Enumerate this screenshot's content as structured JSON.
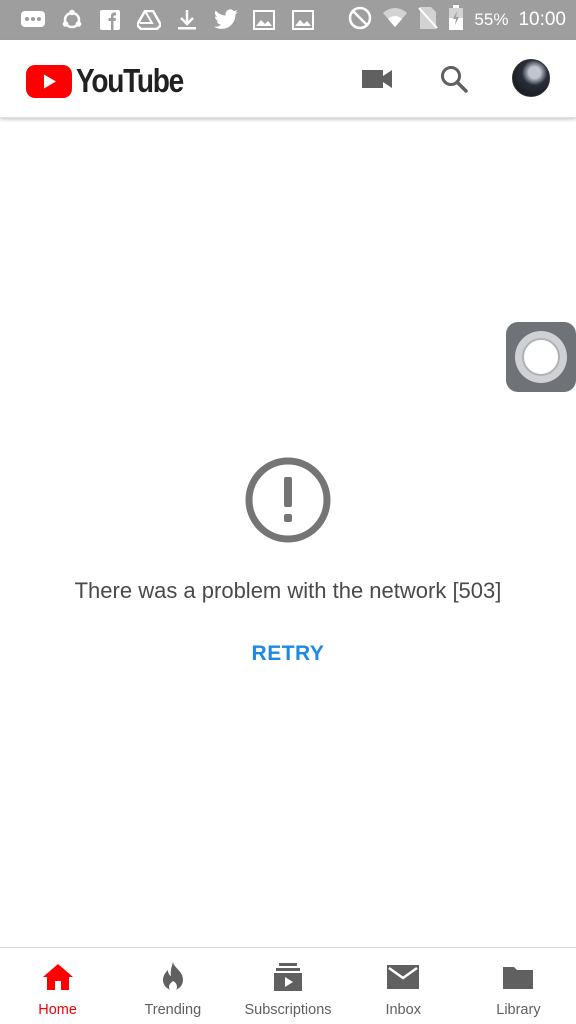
{
  "status_bar": {
    "battery": "55%",
    "time": "10:00",
    "icons": [
      "chat-bubble-icon",
      "sync-icon",
      "facebook-icon",
      "drive-icon",
      "download-icon",
      "twitter-icon",
      "image-icon",
      "image-icon",
      "do-not-disturb-icon",
      "wifi-icon",
      "no-sim-icon",
      "battery-icon"
    ]
  },
  "app_bar": {
    "logo_text": "YouTube",
    "brand_color": "#ff0000",
    "actions": [
      "video-camera-icon",
      "search-icon",
      "avatar"
    ]
  },
  "error": {
    "icon": "exclamation-circle-icon",
    "message": "There was a problem with the network [503]",
    "retry_label": "RETRY",
    "retry_color": "#1e88e5"
  },
  "bottom_nav": {
    "active": "home",
    "items": [
      {
        "label": "Home",
        "icon": "home-icon"
      },
      {
        "label": "Trending",
        "icon": "flame-icon"
      },
      {
        "label": "Subscriptions",
        "icon": "subscriptions-icon"
      },
      {
        "label": "Inbox",
        "icon": "mail-icon"
      },
      {
        "label": "Library",
        "icon": "folder-icon"
      }
    ]
  }
}
